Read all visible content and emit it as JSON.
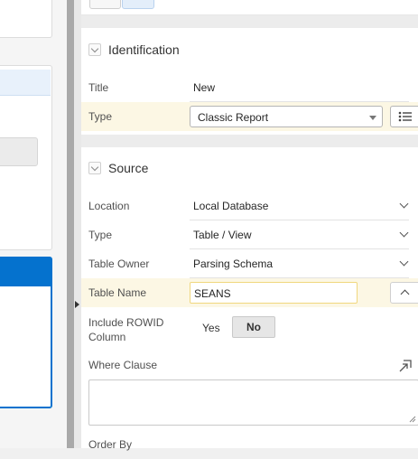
{
  "identification": {
    "group_title": "Identification",
    "title_label": "Title",
    "title_value": "New",
    "type_label": "Type",
    "type_value": "Classic Report"
  },
  "source": {
    "group_title": "Source",
    "location_label": "Location",
    "location_value": "Local Database",
    "type_label": "Type",
    "type_value": "Table / View",
    "owner_label": "Table Owner",
    "owner_value": "Parsing Schema",
    "table_name_label": "Table Name",
    "table_name_value": "SEANS",
    "rowid_label_line1": "Include ROWID",
    "rowid_label_line2": "Column",
    "rowid_yes": "Yes",
    "rowid_no": "No",
    "where_label": "Where Clause",
    "order_by_label": "Order By"
  },
  "colors": {
    "highlight_row": "#fcf7e4",
    "accent_blue": "#0572ce",
    "input_focus_border": "#f0d77e"
  },
  "icons": {
    "list_button": "list-icon",
    "expand_button": "expand-icon",
    "collapse": "chevron-down-icon"
  }
}
